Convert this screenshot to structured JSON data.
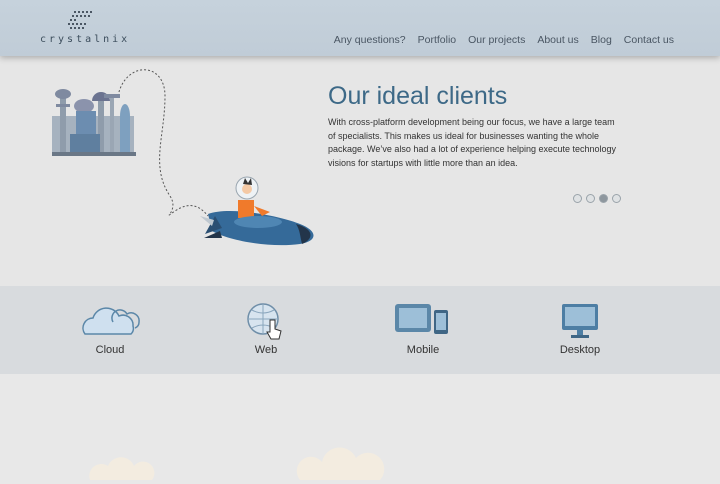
{
  "brand": {
    "name": "crystalnix"
  },
  "nav": {
    "items": [
      {
        "label": "Any questions?"
      },
      {
        "label": "Portfolio"
      },
      {
        "label": "Our projects"
      },
      {
        "label": "About us"
      },
      {
        "label": "Blog"
      },
      {
        "label": "Contact us"
      }
    ]
  },
  "hero": {
    "title": "Our ideal clients",
    "text": "With cross-platform development being our focus, we have a large team of specialists. This makes us ideal for businesses wanting the whole package. We’ve also had a lot of experience helping execute technology visions for startups with little more than an idea.",
    "slides_total": 4,
    "active_slide": 3
  },
  "services": [
    {
      "label": "Cloud",
      "icon": "cloud-icon"
    },
    {
      "label": "Web",
      "icon": "globe-cursor-icon"
    },
    {
      "label": "Mobile",
      "icon": "tablet-phone-icon"
    },
    {
      "label": "Desktop",
      "icon": "monitor-icon"
    }
  ],
  "colors": {
    "header_bg": "#c4d0da",
    "accent": "#3d6987",
    "icon_blue": "#5b87a8",
    "band_bg": "#d8dbde",
    "orange": "#f07a2b"
  }
}
